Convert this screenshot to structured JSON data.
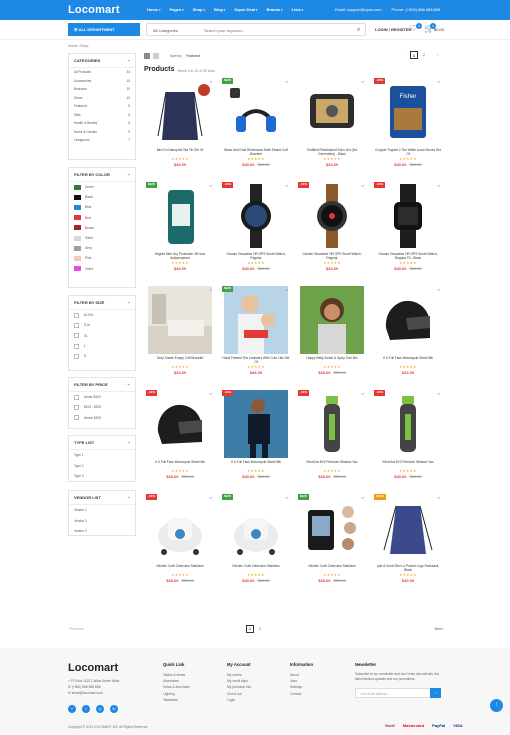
{
  "brand": "Locomart",
  "nav": [
    "Home",
    "Pages",
    "Shop",
    "Blog",
    "Super Deal",
    "Brands",
    "Lists"
  ],
  "contact": {
    "email": "Email: support@vpss.com",
    "phone": "Phone: (+800) 868 868 868"
  },
  "header": {
    "all_department": "ALL DEPARTMENT",
    "category_select": "All Categories",
    "search_placeholder": "Search your keyword...",
    "login": "LOGIN / REGISTER",
    "wishlist_count": "0",
    "cart_count": "0",
    "cart_total": "$0.00"
  },
  "breadcrumb": "Home  /  Shop",
  "sidebar": {
    "categories_title": "CATEGORIES",
    "categories": [
      {
        "label": "All Products",
        "count": "34"
      },
      {
        "label": "Accessories",
        "count": "15"
      },
      {
        "label": "Bedroom",
        "count": "10"
      },
      {
        "label": "Decor",
        "count": "12"
      },
      {
        "label": "Featured",
        "count": "5"
      },
      {
        "label": "Gifts",
        "count": "6"
      },
      {
        "label": "Health & Beauty",
        "count": "8"
      },
      {
        "label": "Home & Garden",
        "count": "9"
      },
      {
        "label": "Livingroom",
        "count": "7"
      }
    ],
    "color_title": "FILTER BY COLOR",
    "colors": [
      {
        "label": "Green",
        "hex": "#2e7d32"
      },
      {
        "label": "Black",
        "hex": "#111111"
      },
      {
        "label": "Blue",
        "hex": "#1e88e5"
      },
      {
        "label": "Red",
        "hex": "#e53935"
      },
      {
        "label": "Brown",
        "hex": "#a1271f"
      },
      {
        "label": "Silver",
        "hex": "#d6d6d6"
      },
      {
        "label": "Grey",
        "hex": "#9e9e9e"
      },
      {
        "label": "Pink",
        "hex": "#f8c4c4"
      },
      {
        "label": "Violet",
        "hex": "#e34ee0"
      }
    ],
    "size_title": "FILTER BY SIZE",
    "sizes": [
      "M-XXL",
      "S-M",
      "XL",
      "L",
      "S"
    ],
    "price_title": "FILTER BY PRICE",
    "prices": [
      "Under $100",
      "$100 - $200",
      "Above $200"
    ],
    "type_title": "TYPE LIST",
    "types": [
      "Type 1",
      "Type 2",
      "Type 3"
    ],
    "vendor_title": "VENDOR LIST",
    "vendors": [
      "Vendor 1",
      "Vendor 2",
      "Vendor 3"
    ]
  },
  "toolbar": {
    "sort_label": "Sort by:",
    "sort_value": "Featured",
    "pages": [
      "1",
      "2"
    ]
  },
  "products_title": "Products",
  "products_count": "Items 1 to 20 of 35 total",
  "products": [
    {
      "name": "Bird On Nanoprint Tea Tin Set Of",
      "price": "$40.00",
      "old": "",
      "tag": "",
      "img": "bag"
    },
    {
      "name": "Black And Gold Rhinestone Multi Strand Cuff Bracelet",
      "price": "$40.00",
      "old": "$50.00",
      "tag": "NEW",
      "img": "headphone"
    },
    {
      "name": "Certified Refurbished Echo Dot (3rd Generation) - Black",
      "price": "$43.00",
      "old": "",
      "tag": "",
      "img": "camera"
    },
    {
      "name": "Cropper Topped 2 Tier White Lunch Boxes Set Of",
      "price": "$40.00",
      "old": "$50.00",
      "tag": "-10%",
      "img": "nuts"
    },
    {
      "name": "Degree Men Dry Protection 48 Hour Antiperspirant",
      "price": "$40.00",
      "old": "",
      "tag": "NEW",
      "img": "deodorant"
    },
    {
      "name": "Garmin Vivoactive HR GPS Smart Watch, Regular",
      "price": "$40.00",
      "old": "$50.00",
      "tag": "-10%",
      "img": "watch1"
    },
    {
      "name": "Garmin Vivoactive HR GPS Smart Watch, Regular",
      "price": "$43.00",
      "old": "",
      "tag": "-10%",
      "img": "watch2"
    },
    {
      "name": "Garmin Vivoactive HR GPS Smart Watch, Regular Fit - Black",
      "price": "$40.00",
      "old": "$50.00",
      "tag": "-10%",
      "img": "watch3"
    },
    {
      "name": "Grey Suede Empty Cuff Bracelet",
      "price": "$43.00",
      "old": "",
      "tag": "",
      "img": "room"
    },
    {
      "name": "Hand Painted Tea Canisters With Cute Lids Set Of",
      "price": "$46.00",
      "old": "",
      "tag": "NEW",
      "img": "mother"
    },
    {
      "name": "Happy Belly Sweet & Spicy Trail Mix",
      "price": "$40.00",
      "old": "$50.00",
      "tag": "",
      "img": "woman"
    },
    {
      "name": "K 6 Full Face Motorcycle Street Bik",
      "price": "$43.00",
      "old": "",
      "tag": "",
      "img": "helmet"
    },
    {
      "name": "K 6 Full Face Motorcycle Street Bik",
      "price": "$40.00",
      "old": "$50.00",
      "tag": "-10%",
      "img": "helmet"
    },
    {
      "name": "K 6 Full Face Motorcycle Street Bik",
      "price": "$40.00",
      "old": "$50.00",
      "tag": "-10%",
      "img": "runner"
    },
    {
      "name": "KitchGar 8V2 Premium Window Vac",
      "price": "$40.00",
      "old": "$50.00",
      "tag": "-10%",
      "img": "trimmer"
    },
    {
      "name": "KitchGar 8V2 Premium Window Vac",
      "price": "$40.00",
      "old": "$50.00",
      "tag": "-10%",
      "img": "trimmer"
    },
    {
      "name": "Kitchen Craft Clearview Stainless",
      "price": "$40.00",
      "old": "$50.00",
      "tag": "-10%",
      "img": "steamer"
    },
    {
      "name": "Kitchen Craft Clearview Stainless",
      "price": "$40.00",
      "old": "$50.00",
      "tag": "NEW",
      "img": "steamer"
    },
    {
      "name": "Kitchen Craft Clearview Stainless",
      "price": "$40.00",
      "old": "$50.00",
      "tag": "NEW",
      "img": "appliance"
    },
    {
      "name": "Lyle & Scott Slim Lo Pocket Logo Rucksack, Black",
      "price": "$40.00",
      "old": "",
      "tag": "SALE",
      "img": "bag2"
    }
  ],
  "pagination": {
    "prev": "Previous",
    "next": "Next",
    "pages": [
      "1",
      "2"
    ]
  },
  "footer": {
    "address": "PO Box 1622 Collins Street West",
    "phone": "(+800) 868 868 868",
    "email": "email@locomart.com",
    "cols": [
      {
        "title": "Quick Link",
        "items": [
          "Tables & desks",
          "Wardrobes",
          "Sofas & armchairs",
          "Lighting",
          "Tableware"
        ]
      },
      {
        "title": "My Account",
        "items": [
          "My orders",
          "My credit slips",
          "My personal info",
          "Check out",
          "Login"
        ]
      },
      {
        "title": "Information",
        "items": [
          "About",
          "Jobs",
          "Sitemap",
          "Contact"
        ]
      }
    ],
    "newsletter_title": "Newsletter",
    "newsletter_text": "Subscribe to our newsletter and don't miss new arrivals, the latest fashion updates and our promotions.",
    "newsletter_placeholder": "Your email address",
    "copyright": "Copyright © 2019 LOCOMART WS. All Rights Reserved.",
    "payments": [
      "Skrill",
      "Mastercard",
      "PayPal",
      "VISA"
    ]
  }
}
